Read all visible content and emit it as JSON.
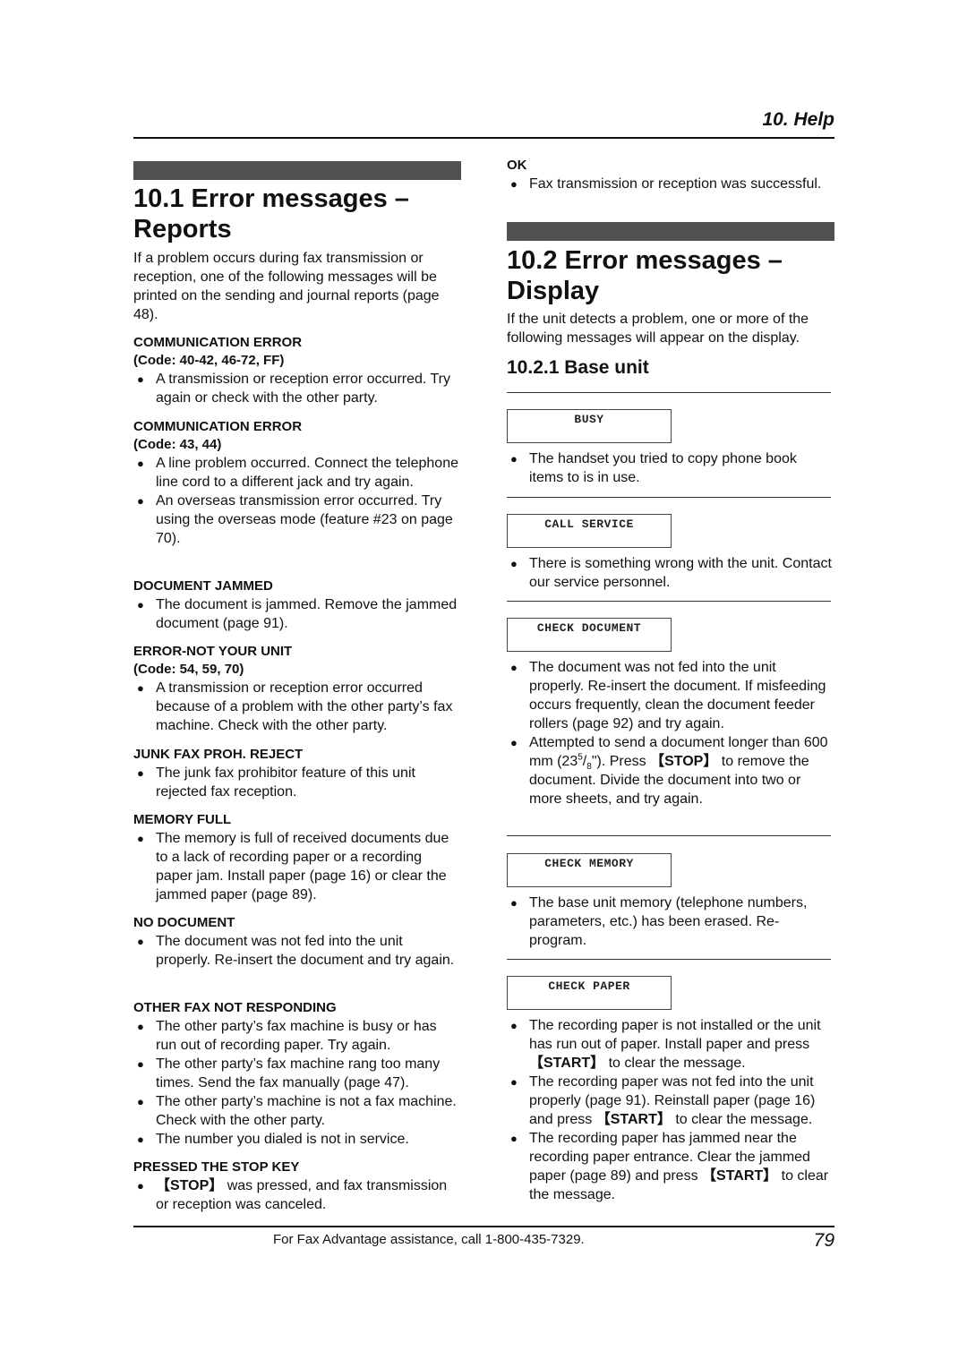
{
  "header": {
    "title": "10. Help"
  },
  "left": {
    "section_title_line1": "10.1 Error messages –",
    "section_title_line2": "Reports",
    "intro": "If a problem occurs during fax transmission or reception, one of the following messages will be printed on the sending and journal reports (page 48).",
    "items": [
      {
        "head": "COMMUNICATION ERROR",
        "code": "(Code: 40-42, 46-72, FF)",
        "bullets": [
          "A transmission or reception error occurred. Try again or check with the other party."
        ]
      },
      {
        "head": "COMMUNICATION ERROR",
        "code": "(Code: 43, 44)",
        "bullets": [
          "A line problem occurred. Connect the telephone line cord to a different jack and try again.",
          "An overseas transmission error occurred. Try using the overseas mode (feature #23 on page 70)."
        ]
      },
      {
        "head": "DOCUMENT JAMMED",
        "bullets": [
          "The document is jammed. Remove the jammed document (page 91)."
        ]
      },
      {
        "head": "ERROR-NOT YOUR UNIT",
        "code": "(Code: 54, 59, 70)",
        "bullets": [
          "A transmission or reception error occurred because of a problem with the other party’s fax machine. Check with the other party."
        ]
      },
      {
        "head": "JUNK FAX PROH. REJECT",
        "bullets": [
          "The junk fax prohibitor feature of this unit rejected fax reception."
        ]
      },
      {
        "head": "MEMORY FULL",
        "bullets": [
          "The memory is full of received documents due to a lack of recording paper or a recording paper jam. Install paper (page 16) or clear the jammed paper (page 89)."
        ]
      },
      {
        "head": "NO DOCUMENT",
        "bullets": [
          "The document was not fed into the unit properly. Re-insert the document and try again."
        ]
      },
      {
        "head": "OTHER FAX NOT RESPONDING",
        "bullets": [
          "The other party’s fax machine is busy or has run out of recording paper. Try again.",
          "The other party’s fax machine rang too many times. Send the fax manually (page 47).",
          "The other party’s machine is not a fax machine. Check with the other party.",
          "The number you dialed is not in service."
        ]
      },
      {
        "head": "PRESSED THE STOP KEY",
        "bullets_key": "【STOP】",
        "bullets_rest": " was pressed, and fax transmission or reception was canceled."
      }
    ]
  },
  "right": {
    "ok_head": "OK",
    "ok_bullet": "Fax transmission or reception was successful.",
    "section_title_line1": "10.2 Error messages –",
    "section_title_line2": "Display",
    "intro": "If the unit detects a problem, one or more of the following messages will appear on the display.",
    "subsection_title": "10.2.1 Base unit",
    "displays": [
      {
        "label": "BUSY",
        "bullets": [
          "The handset you tried to copy phone book items to is in use."
        ]
      },
      {
        "label": "CALL SERVICE",
        "bullets": [
          "There is something wrong with the unit. Contact our service personnel."
        ]
      },
      {
        "label": "CHECK DOCUMENT",
        "bullets": [
          "The document was not fed into the unit properly. Re-insert the document. If misfeeding occurs frequently, clean the document feeder rollers (page 92) and try again."
        ],
        "bullet2": {
          "a": "Attempted to send a document longer than 600 mm (23",
          "sup": "5",
          "slash": "/",
          "sub": "8",
          "b": "\"). Press ",
          "key": "【STOP】",
          "c": " to remove the document. Divide the document into two or more sheets, and try again."
        }
      },
      {
        "label": "CHECK MEMORY",
        "bullets": [
          "The base unit memory (telephone numbers, parameters, etc.) has been erased. Re-program."
        ]
      },
      {
        "label": "CHECK PAPER",
        "rich_bullets": [
          {
            "a": "The recording paper is not installed or the unit has run out of paper. Install paper and press ",
            "key": "【START】",
            "c": " to clear the message."
          },
          {
            "a": "The recording paper was not fed into the unit properly (page 91). Reinstall paper (page 16) and press ",
            "key": "【START】",
            "c": " to clear the message."
          },
          {
            "a": "The recording paper has jammed near the recording paper entrance. Clear the jammed paper (page 89) and press ",
            "key": "【START】",
            "c": " to clear the message."
          }
        ]
      }
    ]
  },
  "footer": {
    "text": "For Fax Advantage assistance, call 1-800-435-7329.",
    "page_number": "79"
  },
  "bullet_glyph": "●"
}
